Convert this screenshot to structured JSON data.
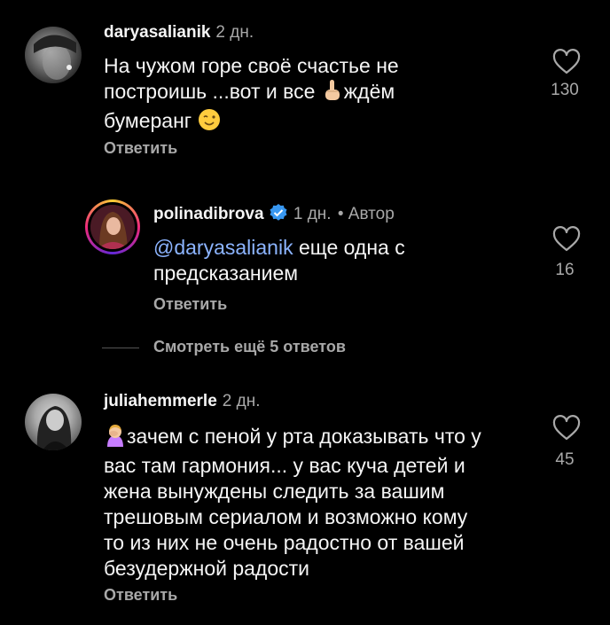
{
  "comments": [
    {
      "username": "daryasalianik",
      "time": "2 дн.",
      "text_line1": "На чужом горе своё счастье не",
      "text_line2a": "построишь ...вот и все ",
      "text_line2b": "ждём",
      "text_line3": "бумеранг ",
      "reply_label": "Ответить",
      "likes": "130",
      "emoji_icons": [
        "point-up-emoji-icon",
        "wink-emoji-icon"
      ]
    },
    {
      "username": "polinadibrova",
      "time": "1 дн.",
      "author_tag": "• Автор",
      "mention": "@daryasalianik",
      "text_line1": " еще одна с",
      "text_line2": "предсказанием",
      "reply_label": "Ответить",
      "likes": "16",
      "verified": true
    },
    {
      "username": "juliahemmerle",
      "time": "2 дн.",
      "text_line1": "зачем с пеной у рта доказывать что у",
      "text_line2": "вас там гармония...  у вас куча детей и",
      "text_line3": "жена вынуждены следить за вашим",
      "text_line4": "трешовым сериалом и возможно кому",
      "text_line5": "то из них не очень радостно от вашей",
      "text_line6": "безудержной радости",
      "reply_label": "Ответить",
      "likes": "45",
      "emoji_icons": [
        "facepalm-emoji-icon"
      ]
    }
  ],
  "view_more_replies": "Смотреть ещё 5 ответов",
  "colors": {
    "background": "#000000",
    "text": "#f5f5f5",
    "secondary": "#a8a8a8",
    "mention": "#8cb4ff",
    "verified": "#3897f0"
  }
}
